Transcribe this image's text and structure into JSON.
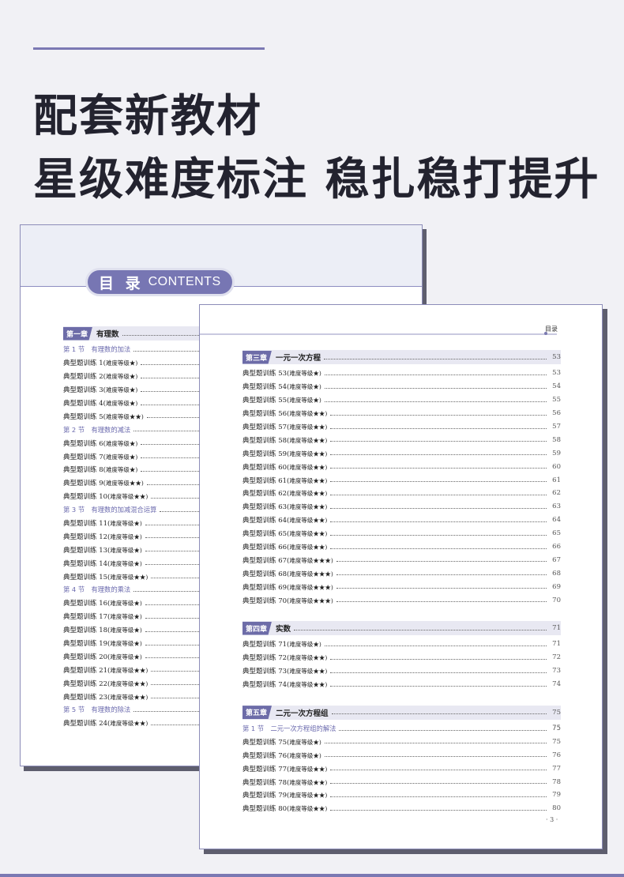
{
  "headline": {
    "line1": "配套新教材",
    "line2": "星级难度标注 稳扎稳打提升"
  },
  "back_page": {
    "contents_cn": "目 录",
    "contents_en": "CONTENTS",
    "entries": [
      {
        "type": "chap",
        "tag": "第一章",
        "title": "有理数"
      },
      {
        "type": "sec",
        "label": "第 1 节　有理数的加法"
      },
      {
        "type": "item",
        "label": "典型题训练 1(",
        "stars": "难度等级★)"
      },
      {
        "type": "item",
        "label": "典型题训练 2(",
        "stars": "难度等级★)"
      },
      {
        "type": "item",
        "label": "典型题训练 3(",
        "stars": "难度等级★)"
      },
      {
        "type": "item",
        "label": "典型题训练 4(",
        "stars": "难度等级★)"
      },
      {
        "type": "item",
        "label": "典型题训练 5(",
        "stars": "难度等级★★)"
      },
      {
        "type": "sec",
        "label": "第 2 节　有理数的减法"
      },
      {
        "type": "item",
        "label": "典型题训练 6(",
        "stars": "难度等级★)"
      },
      {
        "type": "item",
        "label": "典型题训练 7(",
        "stars": "难度等级★)"
      },
      {
        "type": "item",
        "label": "典型题训练 8(",
        "stars": "难度等级★)"
      },
      {
        "type": "item",
        "label": "典型题训练 9(",
        "stars": "难度等级★★)"
      },
      {
        "type": "item",
        "label": "典型题训练 10(",
        "stars": "难度等级★★)"
      },
      {
        "type": "sec",
        "label": "第 3 节　有理数的加减混合运算"
      },
      {
        "type": "item",
        "label": "典型题训练 11(",
        "stars": "难度等级★)"
      },
      {
        "type": "item",
        "label": "典型题训练 12(",
        "stars": "难度等级★)"
      },
      {
        "type": "item",
        "label": "典型题训练 13(",
        "stars": "难度等级★)"
      },
      {
        "type": "item",
        "label": "典型题训练 14(",
        "stars": "难度等级★)"
      },
      {
        "type": "item",
        "label": "典型题训练 15(",
        "stars": "难度等级★★)"
      },
      {
        "type": "sec",
        "label": "第 4 节　有理数的乘法"
      },
      {
        "type": "item",
        "label": "典型题训练 16(",
        "stars": "难度等级★)"
      },
      {
        "type": "item",
        "label": "典型题训练 17(",
        "stars": "难度等级★)"
      },
      {
        "type": "item",
        "label": "典型题训练 18(",
        "stars": "难度等级★)"
      },
      {
        "type": "item",
        "label": "典型题训练 19(",
        "stars": "难度等级★)"
      },
      {
        "type": "item",
        "label": "典型题训练 20(",
        "stars": "难度等级★)"
      },
      {
        "type": "item",
        "label": "典型题训练 21(",
        "stars": "难度等级★★)"
      },
      {
        "type": "item",
        "label": "典型题训练 22(",
        "stars": "难度等级★★)"
      },
      {
        "type": "item",
        "label": "典型题训练 23(",
        "stars": "难度等级★★)"
      },
      {
        "type": "sec",
        "label": "第 5 节　有理数的除法"
      },
      {
        "type": "item",
        "label": "典型题训练 24(",
        "stars": "难度等级★★)"
      }
    ]
  },
  "front_page": {
    "header_label": "目录",
    "page_number": "· 3 ·",
    "groups": [
      {
        "entries": [
          {
            "type": "chap",
            "tag": "第三章",
            "title": "一元一次方程",
            "page": "53"
          },
          {
            "type": "item",
            "label": "典型题训练 53(",
            "stars": "难度等级★)",
            "page": "53"
          },
          {
            "type": "item",
            "label": "典型题训练 54(",
            "stars": "难度等级★)",
            "page": "54"
          },
          {
            "type": "item",
            "label": "典型题训练 55(",
            "stars": "难度等级★)",
            "page": "55"
          },
          {
            "type": "item",
            "label": "典型题训练 56(",
            "stars": "难度等级★★)",
            "page": "56"
          },
          {
            "type": "item",
            "label": "典型题训练 57(",
            "stars": "难度等级★★)",
            "page": "57"
          },
          {
            "type": "item",
            "label": "典型题训练 58(",
            "stars": "难度等级★★)",
            "page": "58"
          },
          {
            "type": "item",
            "label": "典型题训练 59(",
            "stars": "难度等级★★)",
            "page": "59"
          },
          {
            "type": "item",
            "label": "典型题训练 60(",
            "stars": "难度等级★★)",
            "page": "60"
          },
          {
            "type": "item",
            "label": "典型题训练 61(",
            "stars": "难度等级★★)",
            "page": "61"
          },
          {
            "type": "item",
            "label": "典型题训练 62(",
            "stars": "难度等级★★)",
            "page": "62"
          },
          {
            "type": "item",
            "label": "典型题训练 63(",
            "stars": "难度等级★★)",
            "page": "63"
          },
          {
            "type": "item",
            "label": "典型题训练 64(",
            "stars": "难度等级★★)",
            "page": "64"
          },
          {
            "type": "item",
            "label": "典型题训练 65(",
            "stars": "难度等级★★)",
            "page": "65"
          },
          {
            "type": "item",
            "label": "典型题训练 66(",
            "stars": "难度等级★★)",
            "page": "66"
          },
          {
            "type": "item",
            "label": "典型题训练 67(",
            "stars": "难度等级★★★)",
            "page": "67"
          },
          {
            "type": "item",
            "label": "典型题训练 68(",
            "stars": "难度等级★★★)",
            "page": "68"
          },
          {
            "type": "item",
            "label": "典型题训练 69(",
            "stars": "难度等级★★★)",
            "page": "69"
          },
          {
            "type": "item",
            "label": "典型题训练 70(",
            "stars": "难度等级★★★)",
            "page": "70"
          }
        ]
      },
      {
        "entries": [
          {
            "type": "chap",
            "tag": "第四章",
            "title": "实数",
            "page": "71"
          },
          {
            "type": "item",
            "label": "典型题训练 71(",
            "stars": "难度等级★)",
            "page": "71"
          },
          {
            "type": "item",
            "label": "典型题训练 72(",
            "stars": "难度等级★★)",
            "page": "72"
          },
          {
            "type": "item",
            "label": "典型题训练 73(",
            "stars": "难度等级★★)",
            "page": "73"
          },
          {
            "type": "item",
            "label": "典型题训练 74(",
            "stars": "难度等级★★)",
            "page": "74"
          }
        ]
      },
      {
        "entries": [
          {
            "type": "chap",
            "tag": "第五章",
            "title": "二元一次方程组",
            "page": "75"
          },
          {
            "type": "sec",
            "label": "第 1 节　二元一次方程组的解法",
            "page": "75"
          },
          {
            "type": "item",
            "label": "典型题训练 75(",
            "stars": "难度等级★)",
            "page": "75"
          },
          {
            "type": "item",
            "label": "典型题训练 76(",
            "stars": "难度等级★)",
            "page": "76"
          },
          {
            "type": "item",
            "label": "典型题训练 77(",
            "stars": "难度等级★★)",
            "page": "77"
          },
          {
            "type": "item",
            "label": "典型题训练 78(",
            "stars": "难度等级★★)",
            "page": "78"
          },
          {
            "type": "item",
            "label": "典型题训练 79(",
            "stars": "难度等级★★)",
            "page": "79"
          },
          {
            "type": "item",
            "label": "典型题训练 80(",
            "stars": "难度等级★★)",
            "page": "80"
          }
        ]
      }
    ]
  },
  "colors": {
    "accent": "#7776b3",
    "section_text": "#6a69ad",
    "headline": "#23232f",
    "background": "#f1f1f5"
  }
}
